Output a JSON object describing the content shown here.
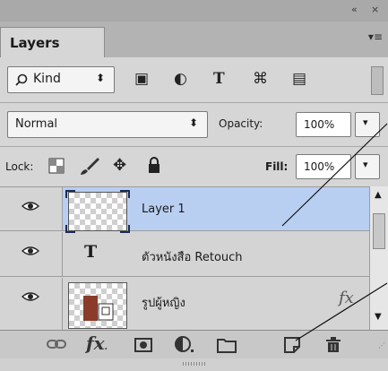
{
  "window": {
    "collapse_glyph": "«",
    "close_glyph": "×"
  },
  "panel": {
    "tab_label": "Layers",
    "menu_glyph": "▾≡"
  },
  "filter": {
    "kind_label": "Kind",
    "kind_icon": "search-icon",
    "type_icons": [
      "image-filter-icon",
      "adjustment-filter-icon",
      "type-filter-icon",
      "shape-filter-icon",
      "smart-object-filter-icon"
    ],
    "type_glyphs": [
      "▣",
      "◐",
      "T",
      "⌘",
      "▤"
    ]
  },
  "blend": {
    "mode": "Normal",
    "opacity_label": "Opacity:",
    "opacity_value": "100%"
  },
  "lock": {
    "label": "Lock:",
    "fill_label": "Fill:",
    "fill_value": "100%",
    "icons": [
      "lock-transparent-pixels-icon",
      "lock-image-pixels-icon",
      "lock-position-icon",
      "lock-all-icon"
    ]
  },
  "layers": [
    {
      "name": "Layer 1",
      "kind": "pixel",
      "visible": true,
      "selected": true
    },
    {
      "name": "ตัวหนังสือ Retouch",
      "kind": "type",
      "visible": true,
      "selected": false
    },
    {
      "name": "รูปผู้หญิง",
      "kind": "smart-object",
      "visible": true,
      "selected": false,
      "has_fx": true
    }
  ],
  "bottom_icons": [
    "link-layers-icon",
    "fx-icon",
    "add-mask-icon",
    "adjustment-layer-icon",
    "new-group-icon",
    "new-layer-icon",
    "trash-icon"
  ],
  "colors": {
    "selected_row": "#b9cff2",
    "panel_bg": "#d6d6d6",
    "header_bg": "#a9a9a9"
  }
}
